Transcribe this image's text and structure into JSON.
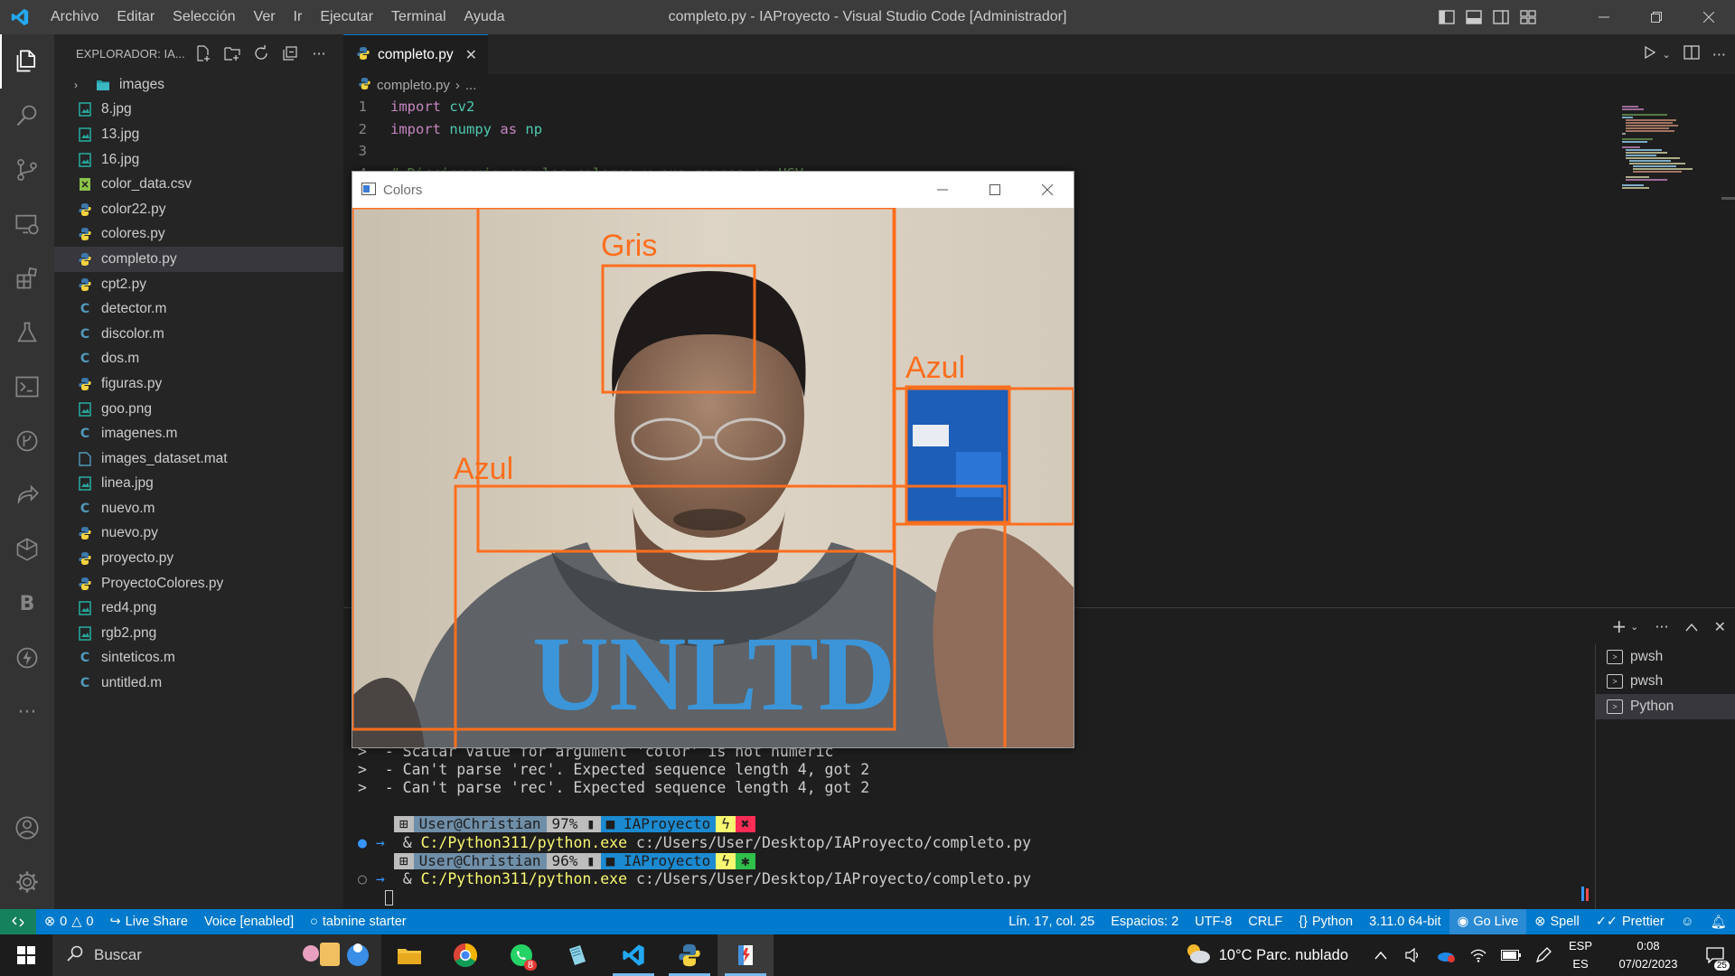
{
  "titlebar": {
    "menu": [
      "Archivo",
      "Editar",
      "Selección",
      "Ver",
      "Ir",
      "Ejecutar",
      "Terminal",
      "Ayuda"
    ],
    "window_title": "completo.py - IAProyecto - Visual Studio Code [Administrador]"
  },
  "sidebar": {
    "title": "EXPLORADOR: IA...",
    "items": [
      {
        "label": "images",
        "type": "folder",
        "icon": "folder-icon"
      },
      {
        "label": "8.jpg",
        "type": "image"
      },
      {
        "label": "13.jpg",
        "type": "image"
      },
      {
        "label": "16.jpg",
        "type": "image"
      },
      {
        "label": "color_data.csv",
        "type": "csv"
      },
      {
        "label": "color22.py",
        "type": "py"
      },
      {
        "label": "colores.py",
        "type": "py"
      },
      {
        "label": "completo.py",
        "type": "py"
      },
      {
        "label": "cpt2.py",
        "type": "py"
      },
      {
        "label": "detector.m",
        "type": "m"
      },
      {
        "label": "discolor.m",
        "type": "m"
      },
      {
        "label": "dos.m",
        "type": "m"
      },
      {
        "label": "figuras.py",
        "type": "py"
      },
      {
        "label": "goo.png",
        "type": "image"
      },
      {
        "label": "imagenes.m",
        "type": "m"
      },
      {
        "label": "images_dataset.mat",
        "type": "file"
      },
      {
        "label": "linea.jpg",
        "type": "image"
      },
      {
        "label": "nuevo.m",
        "type": "m"
      },
      {
        "label": "nuevo.py",
        "type": "py"
      },
      {
        "label": "proyecto.py",
        "type": "py"
      },
      {
        "label": "ProyectoColores.py",
        "type": "py"
      },
      {
        "label": "red4.png",
        "type": "image"
      },
      {
        "label": "rgb2.png",
        "type": "image"
      },
      {
        "label": "sinteticos.m",
        "type": "m"
      },
      {
        "label": "untitled.m",
        "type": "m"
      }
    ],
    "selected": "completo.py"
  },
  "editor": {
    "tab_label": "completo.py",
    "breadcrumb_file": "completo.py",
    "breadcrumb_rest": "...",
    "lines": [
      {
        "num": "1",
        "kw": "import",
        "rest": " ",
        "mod": "cv2",
        "tail": ""
      },
      {
        "num": "2",
        "kw": "import",
        "rest": " ",
        "mod": "numpy",
        "tail": " as np"
      },
      {
        "num": "3",
        "kw": "",
        "rest": "",
        "mod": "",
        "tail": ""
      },
      {
        "num": "4",
        "kw": "",
        "rest": "",
        "mod": "",
        "tail": "# Diccionario con los colores y sus rangos en HSV"
      }
    ]
  },
  "panel": {
    "terminals": [
      "pwsh",
      "pwsh",
      "Python"
    ],
    "active_terminal": "Python",
    "output_lines": [
      ">  - Scalar value for argument 'color' is not numeric",
      ">  - Can't parse 'rec'. Expected sequence length 4, got 2",
      ">  - Can't parse 'rec'. Expected sequence length 4, got 2"
    ],
    "prompts": [
      {
        "user": "User@Christian",
        "battery": "97%",
        "folder": "IAProyecto",
        "exe": "C:/Python311/python.exe",
        "path": "c:/Users/User/Desktop/IAProyecto/completo.py",
        "status": "error"
      },
      {
        "user": "User@Christian",
        "battery": "96%",
        "folder": "IAProyecto",
        "exe": "C:/Python311/python.exe",
        "path": "c:/Users/User/Desktop/IAProyecto/completo.py",
        "status": "running"
      }
    ],
    "amp": "&",
    "arrow": "→"
  },
  "cv_window": {
    "title": "Colors",
    "detections": [
      {
        "label": "Gris"
      },
      {
        "label": "Azul"
      },
      {
        "label": "Azul"
      }
    ],
    "shirt_text": "UNLTD",
    "box_color": "#ff6f1e"
  },
  "statusbar": {
    "errors": "0",
    "warnings": "0",
    "live_share": "Live Share",
    "voice": "Voice [enabled]",
    "tabnine": "tabnine starter",
    "position": "Lín. 17, col. 25",
    "spaces": "Espacios: 2",
    "encoding": "UTF-8",
    "eol": "CRLF",
    "language": "Python",
    "interpreter": "3.11.0 64-bit",
    "go_live": "Go Live",
    "spell": "Spell",
    "prettier": "Prettier"
  },
  "taskbar": {
    "search_placeholder": "Buscar",
    "whatsapp_badge": "8",
    "weather": "10°C  Parc. nublado",
    "lang_top": "ESP",
    "lang_bottom": "ES",
    "time": "0:08",
    "date": "07/02/2023",
    "notifications": "25"
  }
}
